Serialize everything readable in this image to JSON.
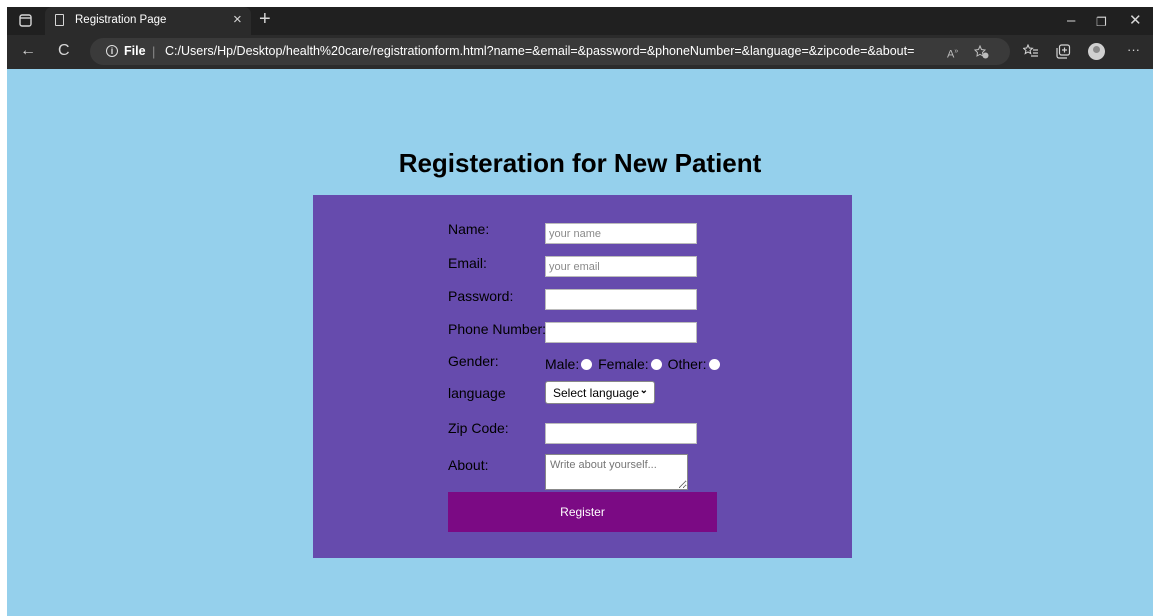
{
  "browser": {
    "tab_title": "Registration Page",
    "tab_close": "×",
    "new_tab": "+",
    "window_controls": {
      "minimize": "–",
      "restore": "❐",
      "close": "✕"
    },
    "nav": {
      "back": "←",
      "refresh": "C"
    },
    "address": {
      "info": "i",
      "scheme_label": "File",
      "separator": "|",
      "url": "C:/Users/Hp/Desktop/health%20care/registrationform.html?name=&email=&password=&phoneNumber=&language=&zipcode=&about="
    },
    "more": "···",
    "icons": [
      "sidebar-toggle-icon",
      "page-icon",
      "read-aloud-icon",
      "favorite-add-icon",
      "favorites-icon",
      "collections-icon",
      "profile-avatar-icon",
      "more-options-icon"
    ]
  },
  "page": {
    "heading": "Registeration for New Patient",
    "form": {
      "name_label": "Name:",
      "name_placeholder": "your name",
      "email_label": "Email:",
      "email_placeholder": "your email",
      "password_label": "Password:",
      "phone_label": "Phone Number:",
      "gender_label": "Gender:",
      "gender_male": "Male:",
      "gender_female": "Female:",
      "gender_other": "Other:",
      "language_label": "language",
      "language_selected": "Select language",
      "zip_label": "Zip Code:",
      "about_label": "About:",
      "about_placeholder": "Write about yourself...",
      "register_label": "Register"
    }
  },
  "colors": {
    "page_bg": "#95d0ec",
    "panel_bg": "#664bad",
    "button_bg": "#7b0a84",
    "titlebar_bg": "#202020",
    "navbar_bg": "#2b2b2b"
  }
}
